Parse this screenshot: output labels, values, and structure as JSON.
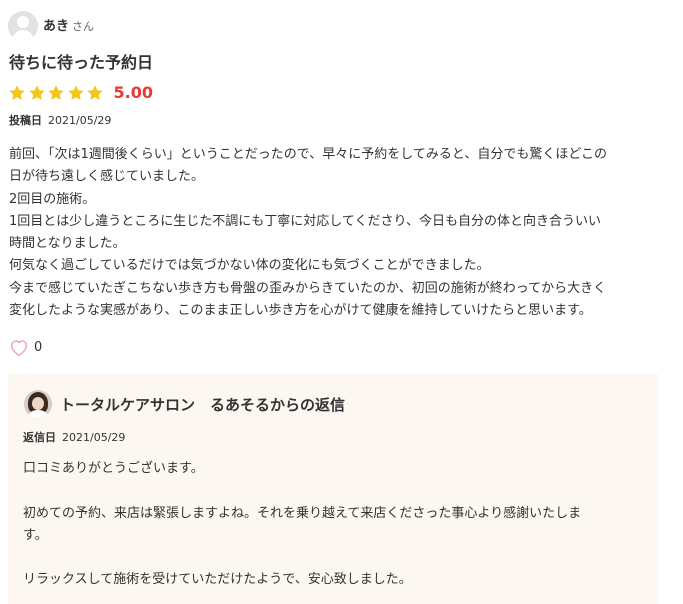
{
  "review": {
    "user_name": "あき",
    "honorific": "さん",
    "title": "待ちに待った予約日",
    "rating": 5,
    "score": "5.00",
    "posted_label": "投稿日",
    "posted_date": "2021/05/29",
    "body_lines": [
      "前回、「次は1週間後くらい」ということだったので、早々に予約をしてみると、自分でも驚くほどこの",
      "日が待ち遠しく感じていました。",
      "2回目の施術。",
      "1回目とは少し違うところに生じた不調にも丁寧に対応してくださり、今日も自分の体と向き合ういい",
      "時間となりました。",
      "何気なく過ごしているだけでは気づかない体の変化にも気づくことができました。",
      "今まで感じていたぎこちない歩き方も骨盤の歪みからきていたのか、初回の施術が終わってから大きく",
      "変化したような実感があり、このまま正しい歩き方を心がけて健康を維持していけたらと思います。"
    ],
    "like_count": "0"
  },
  "reply": {
    "title": "トータルケアサロン　るあそるからの返信",
    "date_label": "返信日",
    "date": "2021/05/29",
    "lines": [
      "口コミありがとうございます。",
      "",
      "初めての予約、来店は緊張しますよね。それを乗り越えて来店くださった事心より感謝いたしま",
      "す。",
      "",
      "リラックスして施術を受けていただけたようで、安心致しました。"
    ]
  },
  "colors": {
    "star": "#f5c518",
    "score": "#e8382f",
    "heart": "#e8a0a5",
    "reply_bg": "#fdf7f1"
  }
}
